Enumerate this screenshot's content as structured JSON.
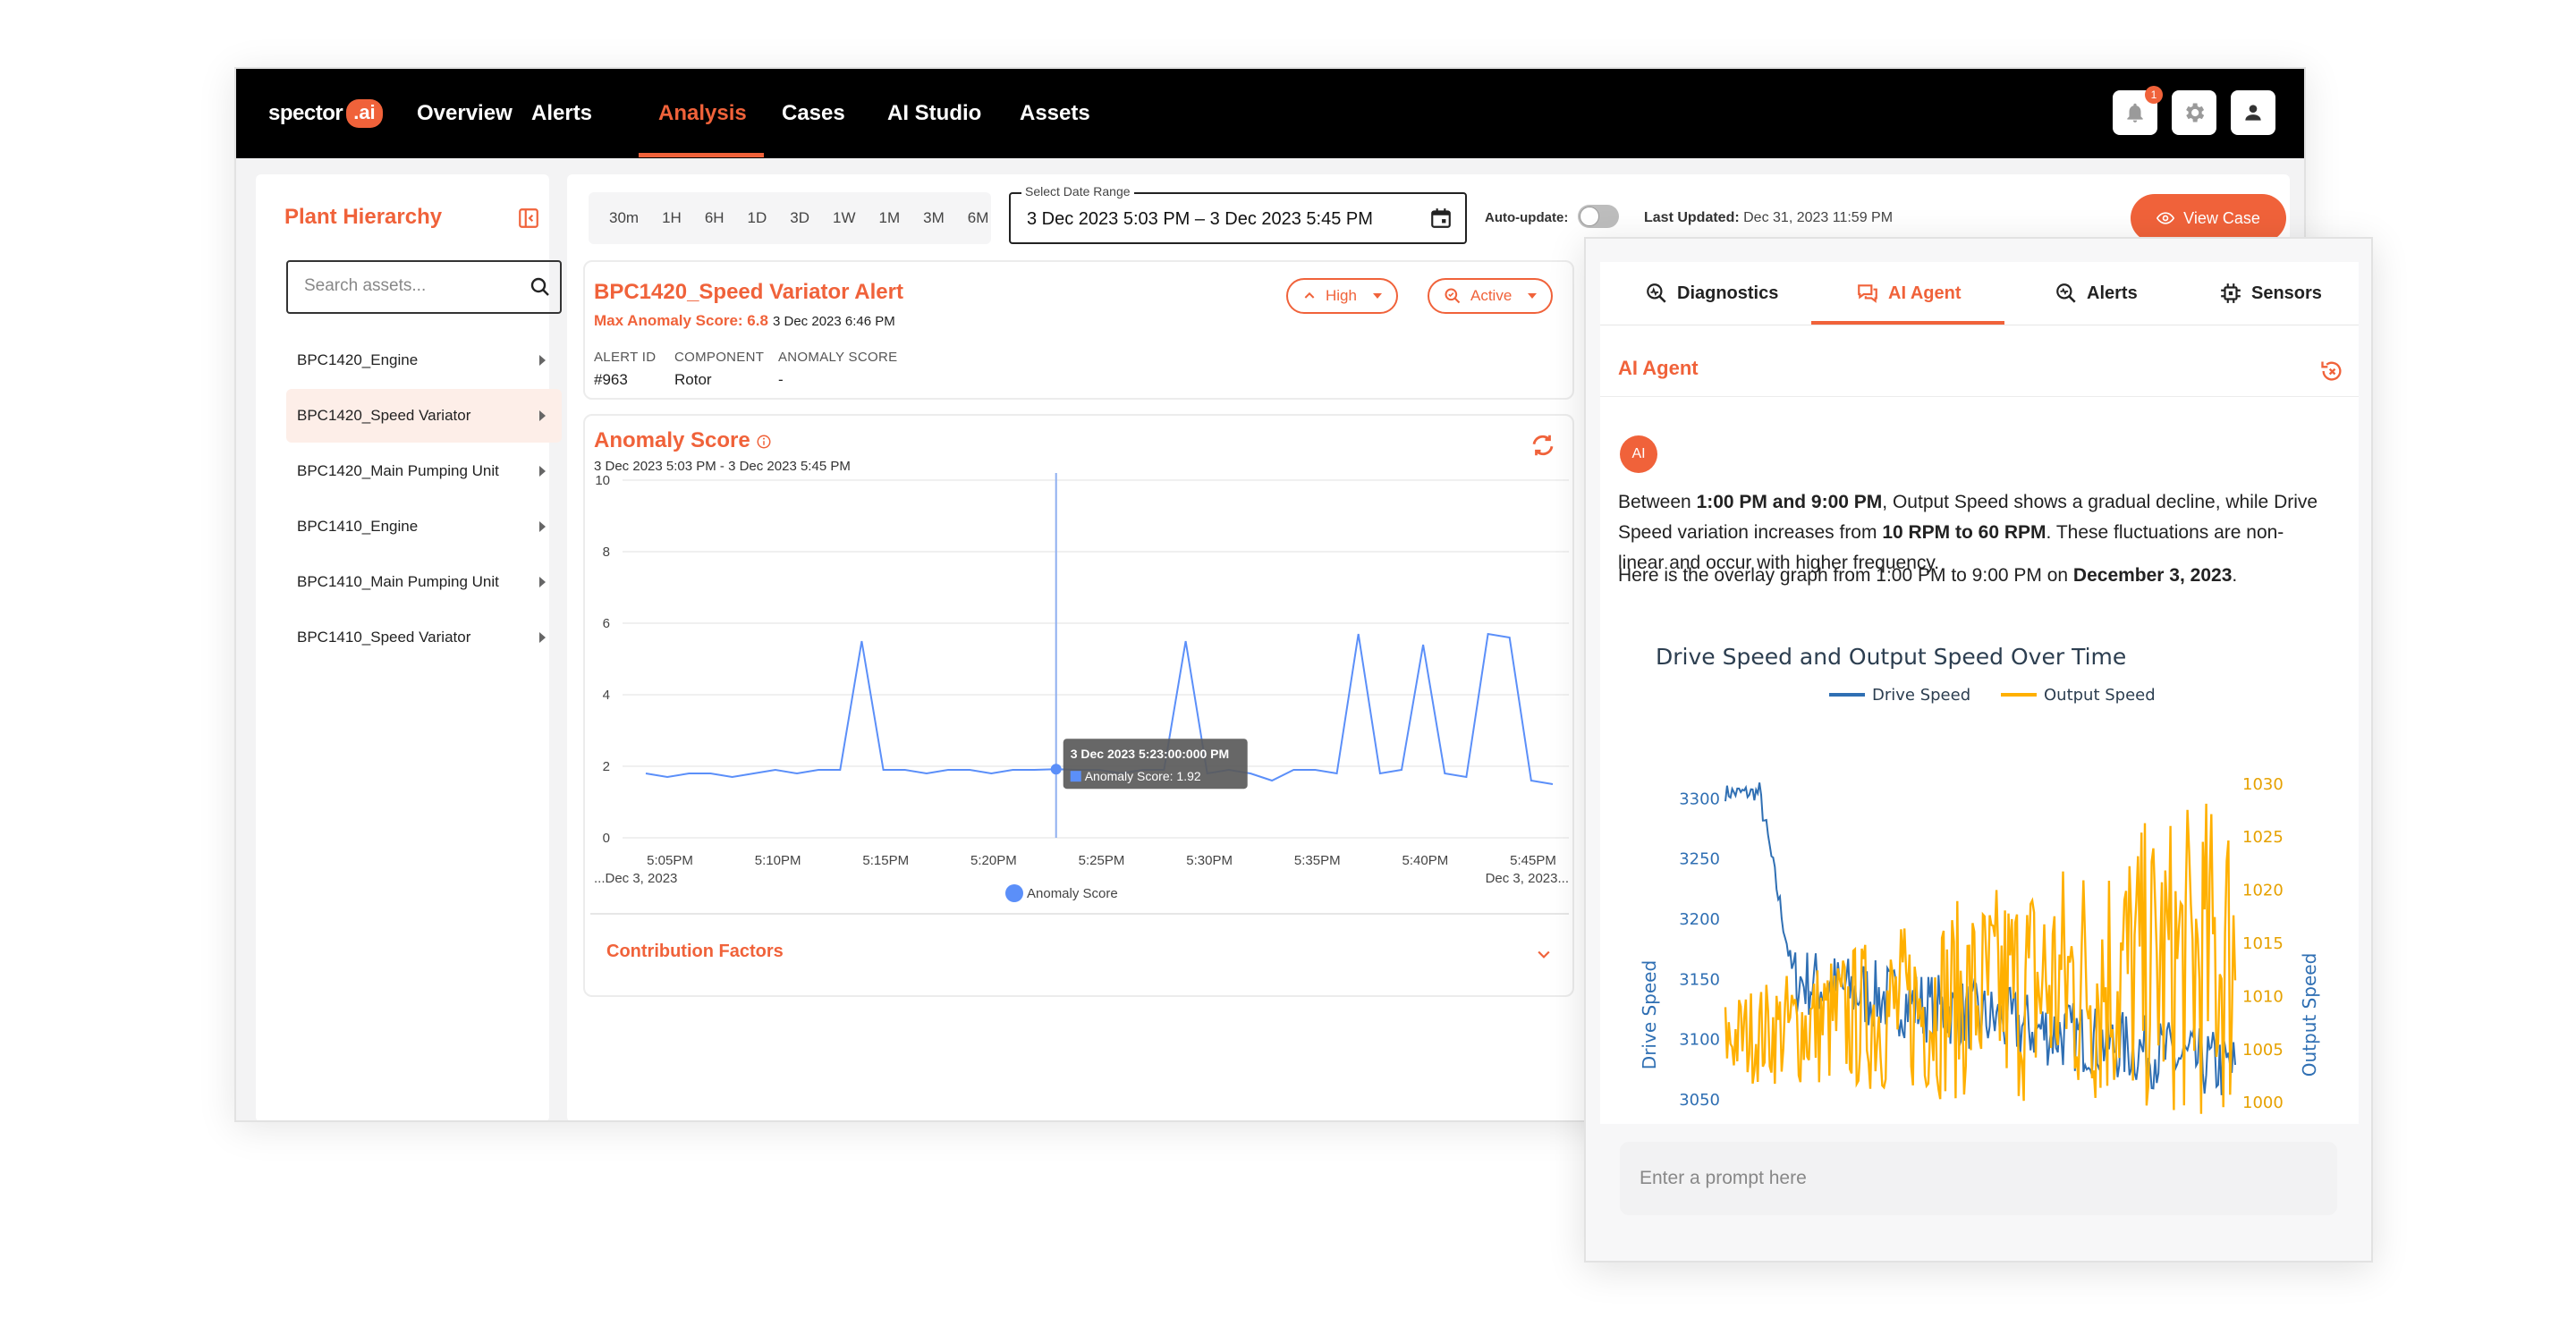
{
  "topbar": {
    "logo_word": "spector",
    "logo_badge": ".ai",
    "nav": [
      "Overview",
      "Alerts",
      "Analysis",
      "Cases",
      "AI Studio",
      "Assets"
    ],
    "active_nav": "Analysis",
    "notification_count": "1",
    "icons": [
      "bell-icon",
      "gear-icon",
      "user-icon"
    ]
  },
  "sidebar": {
    "title": "Plant Hierarchy",
    "search_placeholder": "Search assets...",
    "items": [
      "BPC1420_Engine",
      "BPC1420_Speed Variator",
      "BPC1420_Main Pumping Unit",
      "BPC1410_Engine",
      "BPC1410_Main Pumping Unit",
      "BPC1410_Speed Variator"
    ],
    "selected": "BPC1420_Speed Variator"
  },
  "toolbar": {
    "ranges": [
      "30m",
      "1H",
      "6H",
      "1D",
      "3D",
      "1W",
      "1M",
      "3M",
      "6M"
    ],
    "date_range_label": "Select Date Range",
    "date_range_value": "3 Dec 2023 5:03 PM – 3 Dec 2023 5:45 PM",
    "auto_update_label": "Auto-update:",
    "auto_update_on": false,
    "last_updated_label": "Last Updated:",
    "last_updated_value": "Dec 31, 2023 11:59 PM",
    "view_case": "View Case"
  },
  "alert": {
    "title": "BPC1420_Speed Variator Alert",
    "max_score": "Max Anomaly Score: 6.8",
    "date": "3 Dec 2023 6:46 PM",
    "severity": "High",
    "status": "Active",
    "meta": [
      {
        "label": "ALERT ID",
        "value": "#963"
      },
      {
        "label": "COMPONENT",
        "value": "Rotor"
      },
      {
        "label": "ANOMALY SCORE",
        "value": "-"
      }
    ]
  },
  "anomaly": {
    "title": "Anomaly Score",
    "subtitle": "3 Dec 2023 5:03 PM - 3 Dec 2023 5:45 PM",
    "tooltip_time": "3 Dec 2023 5:23:00:000 PM",
    "tooltip_value": "Anomaly Score: 1.92",
    "contribution_label": "Contribution Factors"
  },
  "ai_panel": {
    "tabs": [
      "Diagnostics",
      "AI Agent",
      "Alerts",
      "Sensors"
    ],
    "active_tab": "AI Agent",
    "heading": "AI Agent",
    "avatar": "AI",
    "message1": {
      "t1": "Between ",
      "b1": "1:00 PM and 9:00 PM",
      "t2": ", Output Speed shows a gradual decline, while Drive Speed variation increases from ",
      "b2": "10 RPM to 60 RPM",
      "t3": ". These fluctuations are non-linear and occur with higher frequency."
    },
    "message2": {
      "t1": "Here is the overlay graph from 1:00 PM to 9:00 PM on ",
      "b1": "December 3, 2023",
      "t2": "."
    },
    "prompt_placeholder": "Enter a prompt here"
  },
  "chart_data": [
    {
      "type": "line",
      "ylim": [
        0,
        10
      ],
      "yticks": [
        "0",
        "2",
        "4",
        "6",
        "8",
        "10"
      ],
      "xticks": [
        "5:05PM",
        "5:10PM",
        "5:15PM",
        "5:20PM",
        "5:25PM",
        "5:30PM",
        "5:35PM",
        "5:40PM",
        "5:45PM"
      ],
      "x_range_labels": [
        "...Dec 3, 2023",
        "Dec 3, 2023..."
      ],
      "legend": [
        "Anomaly Score"
      ],
      "series": [
        {
          "name": "Anomaly Score",
          "color": "#5b8ff9",
          "values": [
            1.8,
            1.7,
            1.8,
            1.8,
            1.7,
            1.8,
            1.9,
            1.8,
            1.9,
            1.9,
            5.5,
            1.9,
            1.9,
            1.8,
            1.9,
            1.9,
            1.8,
            1.9,
            1.9,
            1.92,
            1.9,
            1.9,
            1.8,
            1.9,
            1.9,
            5.5,
            1.8,
            1.9,
            1.8,
            1.6,
            1.9,
            1.9,
            1.8,
            5.7,
            1.8,
            1.9,
            5.4,
            1.8,
            1.7,
            5.7,
            5.6,
            1.6,
            1.5
          ]
        }
      ]
    },
    {
      "type": "line",
      "title": "Drive Speed and Output Speed Over Time",
      "ylabel": "Drive Speed",
      "ylabel_right": "Output Speed",
      "ylim": [
        3030,
        3330
      ],
      "ylim_right": [
        998,
        1032
      ],
      "yticks_left": [
        "3050",
        "3100",
        "3150",
        "3200",
        "3250",
        "3300"
      ],
      "yticks_right": [
        "1000",
        "1005",
        "1010",
        "1015",
        "1020",
        "1025",
        "1030"
      ],
      "series": [
        {
          "name": "Drive Speed",
          "color": "#2f6fb3",
          "points": 300,
          "start": 3305,
          "drop_to": 3150,
          "end_mean": 3075,
          "noise": 30
        },
        {
          "name": "Output Speed",
          "color": "#ffb000",
          "points": 300,
          "start_mean": 1006,
          "end_mean": 1014,
          "noise_start": 4,
          "noise_end": 16
        }
      ]
    }
  ]
}
